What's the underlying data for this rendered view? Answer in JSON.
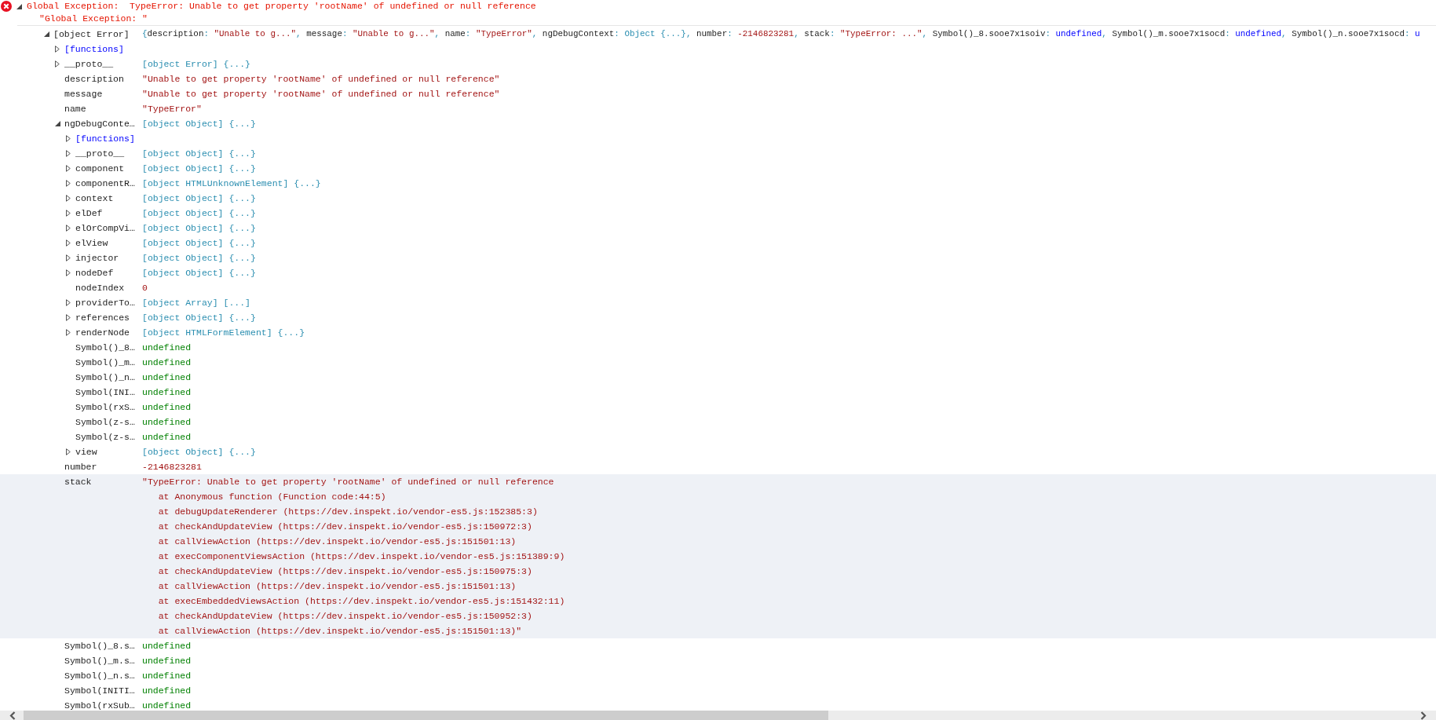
{
  "message": {
    "text": "Global Exception:  TypeError: Unable to get property 'rootName' of undefined or null reference",
    "expanded": true
  },
  "log_string": "\"Global Exception: \"",
  "tree": [
    {
      "kind": "preview",
      "name": "[object Error]",
      "expanded": true,
      "preview": [
        {
          "text": "{",
          "kind": "punct"
        },
        {
          "text": "description",
          "kind": "key"
        },
        {
          "text": ": ",
          "kind": "punct"
        },
        {
          "text": "\"Unable to g...\"",
          "kind": "string"
        },
        {
          "text": ", ",
          "kind": "punct"
        },
        {
          "text": "message",
          "kind": "key"
        },
        {
          "text": ": ",
          "kind": "punct"
        },
        {
          "text": "\"Unable to g...\"",
          "kind": "string"
        },
        {
          "text": ", ",
          "kind": "punct"
        },
        {
          "text": "name",
          "kind": "key"
        },
        {
          "text": ": ",
          "kind": "punct"
        },
        {
          "text": "\"TypeError\"",
          "kind": "string"
        },
        {
          "text": ", ",
          "kind": "punct"
        },
        {
          "text": "ngDebugContext",
          "kind": "key"
        },
        {
          "text": ": ",
          "kind": "punct"
        },
        {
          "text": "Object {...}",
          "kind": "object"
        },
        {
          "text": ", ",
          "kind": "punct"
        },
        {
          "text": "number",
          "kind": "key"
        },
        {
          "text": ": ",
          "kind": "punct"
        },
        {
          "text": "-2146823281",
          "kind": "number"
        },
        {
          "text": ", ",
          "kind": "punct"
        },
        {
          "text": "stack",
          "kind": "key"
        },
        {
          "text": ": ",
          "kind": "punct"
        },
        {
          "text": "\"TypeError: ...\"",
          "kind": "string"
        },
        {
          "text": ", ",
          "kind": "punct"
        },
        {
          "text": "Symbol()_8.sooe7x1soiv",
          "kind": "key"
        },
        {
          "text": ": ",
          "kind": "punct"
        },
        {
          "text": "undefined",
          "kind": "undefined"
        },
        {
          "text": ", ",
          "kind": "punct"
        },
        {
          "text": "Symbol()_m.sooe7x1socd",
          "kind": "key"
        },
        {
          "text": ": ",
          "kind": "punct"
        },
        {
          "text": "undefined",
          "kind": "undefined"
        },
        {
          "text": ", ",
          "kind": "punct"
        },
        {
          "text": "Symbol()_n.sooe7x1socd",
          "kind": "key"
        },
        {
          "text": ": ",
          "kind": "punct"
        },
        {
          "text": "u",
          "kind": "undefined"
        }
      ],
      "children": [
        {
          "kind": "functions",
          "name": "[functions]",
          "expanded": false
        },
        {
          "kind": "object",
          "name": "__proto__",
          "value": "[object Error] {...}",
          "expanded": false
        },
        {
          "kind": "string",
          "name": "description",
          "value": "\"Unable to get property 'rootName' of undefined or null reference\""
        },
        {
          "kind": "string",
          "name": "message",
          "value": "\"Unable to get property 'rootName' of undefined or null reference\""
        },
        {
          "kind": "string",
          "name": "name",
          "value": "\"TypeError\""
        },
        {
          "kind": "object",
          "name": "ngDebugConte…",
          "value": "[object Object] {...}",
          "expanded": true,
          "children": [
            {
              "kind": "functions",
              "name": "[functions]",
              "expanded": false
            },
            {
              "kind": "object",
              "name": "__proto__",
              "value": "[object Object] {...}",
              "expanded": false
            },
            {
              "kind": "object",
              "name": "component",
              "value": "[object Object] {...}",
              "expanded": false
            },
            {
              "kind": "object",
              "name": "componentR…",
              "value": "[object HTMLUnknownElement] {...}",
              "expanded": false
            },
            {
              "kind": "object",
              "name": "context",
              "value": "[object Object] {...}",
              "expanded": false
            },
            {
              "kind": "object",
              "name": "elDef",
              "value": "[object Object] {...}",
              "expanded": false
            },
            {
              "kind": "object",
              "name": "elOrCompVi…",
              "value": "[object Object] {...}",
              "expanded": false
            },
            {
              "kind": "object",
              "name": "elView",
              "value": "[object Object] {...}",
              "expanded": false
            },
            {
              "kind": "object",
              "name": "injector",
              "value": "[object Object] {...}",
              "expanded": false
            },
            {
              "kind": "object",
              "name": "nodeDef",
              "value": "[object Object] {...}",
              "expanded": false
            },
            {
              "kind": "number",
              "name": "nodeIndex",
              "value": "0"
            },
            {
              "kind": "object",
              "name": "providerTo…",
              "value": "[object Array] [...]",
              "expanded": false
            },
            {
              "kind": "object",
              "name": "references",
              "value": "[object Object] {...}",
              "expanded": false
            },
            {
              "kind": "object",
              "name": "renderNode",
              "value": "[object HTMLFormElement] {...}",
              "expanded": false
            },
            {
              "kind": "undefined",
              "name": "Symbol()_8…",
              "value": "undefined"
            },
            {
              "kind": "undefined",
              "name": "Symbol()_m…",
              "value": "undefined"
            },
            {
              "kind": "undefined",
              "name": "Symbol()_n…",
              "value": "undefined"
            },
            {
              "kind": "undefined",
              "name": "Symbol(INI…",
              "value": "undefined"
            },
            {
              "kind": "undefined",
              "name": "Symbol(rxS…",
              "value": "undefined"
            },
            {
              "kind": "undefined",
              "name": "Symbol(z-s…",
              "value": "undefined"
            },
            {
              "kind": "undefined",
              "name": "Symbol(z-s…",
              "value": "undefined"
            },
            {
              "kind": "object",
              "name": "view",
              "value": "[object Object] {...}",
              "expanded": false
            }
          ]
        },
        {
          "kind": "number",
          "name": "number",
          "value": "-2146823281"
        },
        {
          "kind": "string",
          "name": "stack",
          "value": "\"TypeError: Unable to get property 'rootName' of undefined or null reference\n   at Anonymous function (Function code:44:5)\n   at debugUpdateRenderer (https://dev.inspekt.io/vendor-es5.js:152385:3)\n   at checkAndUpdateView (https://dev.inspekt.io/vendor-es5.js:150972:3)\n   at callViewAction (https://dev.inspekt.io/vendor-es5.js:151501:13)\n   at execComponentViewsAction (https://dev.inspekt.io/vendor-es5.js:151389:9)\n   at checkAndUpdateView (https://dev.inspekt.io/vendor-es5.js:150975:3)\n   at callViewAction (https://dev.inspekt.io/vendor-es5.js:151501:13)\n   at execEmbeddedViewsAction (https://dev.inspekt.io/vendor-es5.js:151432:11)\n   at checkAndUpdateView (https://dev.inspekt.io/vendor-es5.js:150952:3)\n   at callViewAction (https://dev.inspekt.io/vendor-es5.js:151501:13)\"",
          "highlighted": true
        },
        {
          "kind": "undefined",
          "name": "Symbol()_8.s…",
          "value": "undefined"
        },
        {
          "kind": "undefined",
          "name": "Symbol()_m.s…",
          "value": "undefined"
        },
        {
          "kind": "undefined",
          "name": "Symbol()_n.s…",
          "value": "undefined"
        },
        {
          "kind": "undefined",
          "name": "Symbol(INITI…",
          "value": "undefined"
        },
        {
          "kind": "undefined",
          "name": "Symbol(rxSub…",
          "value": "undefined"
        }
      ]
    }
  ]
}
